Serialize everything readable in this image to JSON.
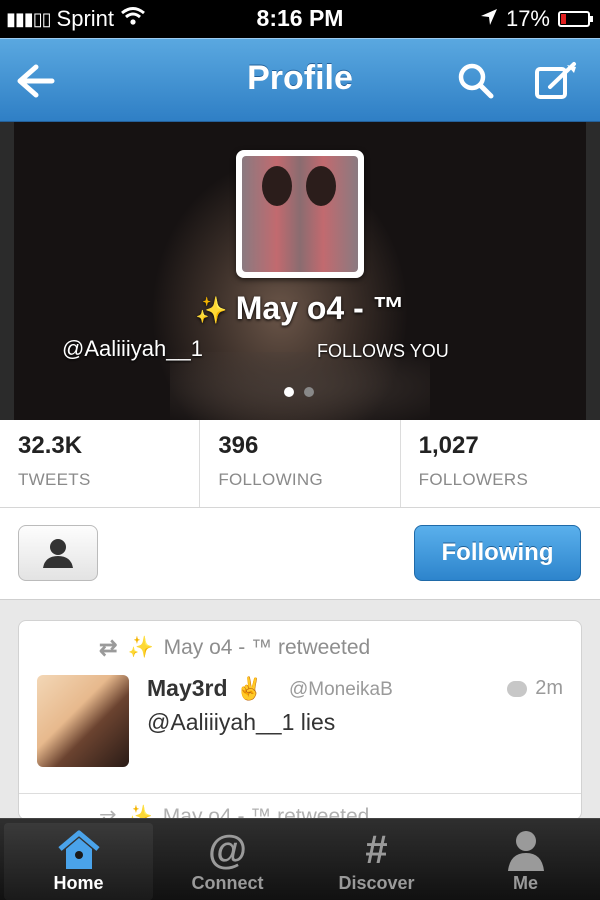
{
  "status_bar": {
    "signal": "▮▮▮▯▯",
    "carrier": "Sprint",
    "time": "8:16 PM",
    "battery_percent": "17%",
    "battery_level": 0.17,
    "icons": [
      "wifi-icon",
      "location-arrow-icon",
      "battery-icon"
    ]
  },
  "nav": {
    "title": "Profile",
    "back_icon": "back-arrow-icon",
    "search_icon": "search-icon",
    "compose_icon": "compose-icon"
  },
  "profile": {
    "display_name": "May o4 - ™",
    "handle": "@Aaliiiyah__1",
    "follows_you": "FOLLOWS YOU",
    "page_dots": 2,
    "active_dot": 0
  },
  "stats": [
    {
      "value": "32.3K",
      "label": "TWEETS"
    },
    {
      "value": "396",
      "label": "FOLLOWING"
    },
    {
      "value": "1,027",
      "label": "FOLLOWERS"
    }
  ],
  "actions": {
    "following_label": "Following",
    "person_icon": "person-icon"
  },
  "tweets": [
    {
      "retweeted_by": "May o4 - ™ retweeted",
      "name": "May3rd",
      "handle": "@MoneikaB",
      "time": "2m",
      "text": "@Aaliiiyah__1 lies"
    },
    {
      "retweeted_by": "May o4 - ™ retweeted"
    }
  ],
  "tabbar": {
    "tabs": [
      {
        "label": "Home",
        "icon": "home-icon",
        "active": true
      },
      {
        "label": "Connect",
        "icon": "at-icon",
        "active": false
      },
      {
        "label": "Discover",
        "icon": "hash-icon",
        "active": false
      },
      {
        "label": "Me",
        "icon": "person-icon",
        "active": false
      }
    ]
  },
  "colors": {
    "nav_blue": "#3a8fd4",
    "following_blue": "#2d84cc",
    "active_tab_icon": "#4aa3ea",
    "battery_red": "#e02020"
  }
}
